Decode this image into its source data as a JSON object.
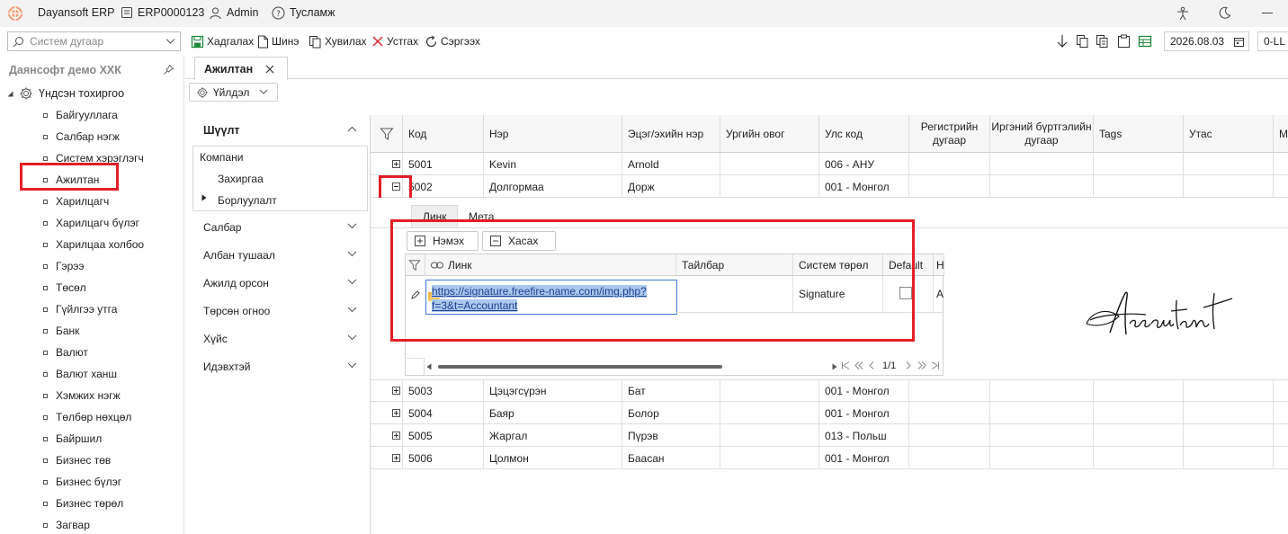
{
  "titlebar": {
    "app_name": "Dayansoft ERP",
    "instance": "ERP0000123",
    "user": "Admin",
    "help": "Тусламж"
  },
  "toolbar": {
    "search_placeholder": "Систем дугаар",
    "save": "Хадгалах",
    "new": "Шинэ",
    "copy": "Хувилах",
    "delete": "Устгах",
    "refresh": "Сэргээх",
    "date": "2026.08.03",
    "code": "0-LL"
  },
  "sidebar": {
    "company": "Даянсофт демо ХХК",
    "root": "Үндсэн тохиргоо",
    "items": [
      "Байгууллага",
      "Салбар нэгж",
      "Систем хэрэглэгч",
      "Ажилтан",
      "Харилцагч",
      "Харилцагч бүлэг",
      "Харилцаа холбоо",
      "Гэрээ",
      "Төсөл",
      "Гүйлгээ утга",
      "Банк",
      "Валют",
      "Валют ханш",
      "Хэмжих нэгж",
      "Төлбөр нөхцөл",
      "Байршил",
      "Бизнес төв",
      "Бизнес бүлэг",
      "Бизнес төрөл",
      "Загвар"
    ]
  },
  "tab": {
    "label": "Ажилтан"
  },
  "action": {
    "label": "Үйлдэл"
  },
  "filter": {
    "title": "Шүүлт",
    "group_label": "Компани",
    "options": [
      "Захиргаа",
      "Борлуулалт"
    ],
    "sections": [
      "Салбар",
      "Албан тушаал",
      "Ажилд орсон",
      "Төрсөн огноо",
      "Хүйс",
      "Идэвхтэй"
    ]
  },
  "grid": {
    "columns": [
      "Код",
      "Нэр",
      "Эцэг/эхийн нэр",
      "Ургийн овог",
      "Улс код",
      "Регистрийн дугаар",
      "Иргэний бүртгэлийн дугаар",
      "Tags",
      "Утас",
      "М"
    ],
    "rows": [
      {
        "code": "5001",
        "name": "Kevin",
        "parent": "Arnold",
        "country": "006 - АНУ"
      },
      {
        "code": "5002",
        "name": "Долгормаа",
        "parent": "Дорж",
        "country": "001 - Монгол"
      },
      {
        "code": "5003",
        "name": "Цэцэгсүрэн",
        "parent": "Бат",
        "country": "001 - Монгол"
      },
      {
        "code": "5004",
        "name": "Баяр",
        "parent": "Болор",
        "country": "001 - Монгол"
      },
      {
        "code": "5005",
        "name": "Жаргал",
        "parent": "Пүрэв",
        "country": "013 - Польш"
      },
      {
        "code": "5006",
        "name": "Цолмон",
        "parent": "Баасан",
        "country": "001 - Монгол"
      }
    ]
  },
  "detail": {
    "tabs": [
      "Линк",
      "Мета"
    ],
    "add": "Нэмэх",
    "remove": "Хасах",
    "columns": [
      "Линк",
      "Тайлбар",
      "Систем төрөл",
      "Default",
      "Н"
    ],
    "link_value": "https://signature.freefire-name.com/img.php?f=3&t=Accountant",
    "system_type": "Signature",
    "extra_cell": "А",
    "pager": "1/1",
    "signature_text": "Accountant"
  }
}
